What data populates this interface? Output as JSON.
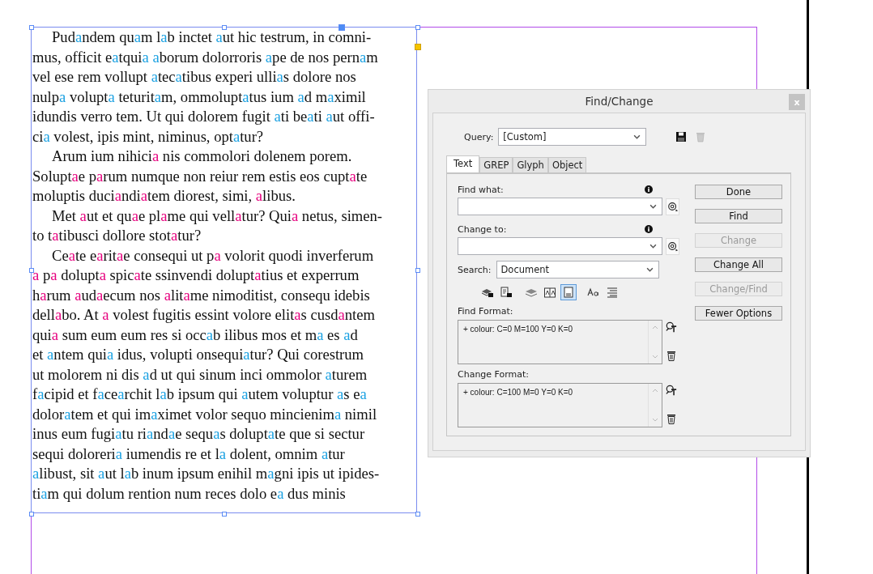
{
  "text_frame": {
    "paragraphs": [
      {
        "lines": [
          [
            "Pud",
            {
              "text": "a",
              "color": "#1ba1e2"
            },
            "ndem qu",
            {
              "text": "a",
              "color": "#1ba1e2"
            },
            "m l",
            {
              "text": "a",
              "color": "#1ba1e2"
            },
            "b inctet ",
            {
              "text": "a",
              "color": "#1ba1e2"
            },
            "ut hic testrum, in comni-"
          ],
          [
            "mus, officit e",
            {
              "text": "a",
              "color": "#1ba1e2"
            },
            "tqui",
            {
              "text": "a a",
              "color": "#1ba1e2"
            },
            "borum dolorroris ",
            {
              "text": "a",
              "color": "#1ba1e2"
            },
            "pe de nos pern",
            {
              "text": "a",
              "color": "#1ba1e2"
            },
            "m"
          ],
          [
            "vel ese rem vollupt ",
            {
              "text": "a",
              "color": "#1ba1e2"
            },
            "tec",
            {
              "text": "a",
              "color": "#1ba1e2"
            },
            "tibus experi ulli",
            {
              "text": "a",
              "color": "#1ba1e2"
            },
            "s dolore nos"
          ],
          [
            "nulp",
            {
              "text": "a",
              "color": "#1ba1e2"
            },
            " volupt",
            {
              "text": "a",
              "color": "#1ba1e2"
            },
            " teturit",
            {
              "text": "a",
              "color": "#1ba1e2"
            },
            "m, ommolupt",
            {
              "text": "a",
              "color": "#1ba1e2"
            },
            "tus ium ",
            {
              "text": "a",
              "color": "#1ba1e2"
            },
            "d m",
            {
              "text": "a",
              "color": "#1ba1e2"
            },
            "ximil"
          ],
          [
            "idundis verro tem. Ut qui dolorem fugit ",
            {
              "text": "a",
              "color": "#1ba1e2"
            },
            "ti be",
            {
              "text": "a",
              "color": "#1ba1e2"
            },
            "ti ",
            {
              "text": "a",
              "color": "#1ba1e2"
            },
            "ut offi-"
          ],
          [
            "ci",
            {
              "text": "a",
              "color": "#1ba1e2"
            },
            " volest, ipis mint, niminus, opt",
            {
              "text": "a",
              "color": "#1ba1e2"
            },
            "tur?"
          ]
        ]
      },
      {
        "lines": [
          [
            "Arum ium nihici",
            {
              "text": "a",
              "color": "#e6007e"
            },
            " nis commolori dolenem porem."
          ],
          [
            "Solupt",
            {
              "text": "a",
              "color": "#e6007e"
            },
            "e p",
            {
              "text": "a",
              "color": "#e6007e"
            },
            "rum numque non reiur rem estis eos cupt",
            {
              "text": "a",
              "color": "#e6007e"
            },
            "te"
          ],
          [
            "moluptis duci",
            {
              "text": "a",
              "color": "#e6007e"
            },
            "ndi",
            {
              "text": "a",
              "color": "#e6007e"
            },
            "tem diorest, simi, ",
            {
              "text": "a",
              "color": "#e6007e"
            },
            "libus."
          ]
        ]
      },
      {
        "lines": [
          [
            "Met ",
            {
              "text": "a",
              "color": "#e6007e"
            },
            "ut et qu",
            {
              "text": "a",
              "color": "#e6007e"
            },
            "e pl",
            {
              "text": "a",
              "color": "#e6007e"
            },
            "me qui vell",
            {
              "text": "a",
              "color": "#e6007e"
            },
            "tur? Qui",
            {
              "text": "a",
              "color": "#e6007e"
            },
            " netus, simen-"
          ],
          [
            "to t",
            {
              "text": "a",
              "color": "#e6007e"
            },
            "tibusci dollore stot",
            {
              "text": "a",
              "color": "#e6007e"
            },
            "tur?"
          ]
        ]
      },
      {
        "lines": [
          [
            "Ce",
            {
              "text": "a",
              "color": "#e6007e"
            },
            "te e",
            {
              "text": "a",
              "color": "#e6007e"
            },
            "rit",
            {
              "text": "a",
              "color": "#e6007e"
            },
            "e consequi ut p",
            {
              "text": "a",
              "color": "#e6007e"
            },
            " volorit quodi inverferum"
          ],
          [
            {
              "text": "a",
              "color": "#e6007e"
            },
            " p",
            {
              "text": "a",
              "color": "#e6007e"
            },
            " dolupt",
            {
              "text": "a",
              "color": "#e6007e"
            },
            " spic",
            {
              "text": "a",
              "color": "#e6007e"
            },
            "te ssinvendi dolupt",
            {
              "text": "a",
              "color": "#e6007e"
            },
            "tius et experrum"
          ],
          [
            "h",
            {
              "text": "a",
              "color": "#e6007e"
            },
            "rum ",
            {
              "text": "a",
              "color": "#e6007e"
            },
            "ud",
            {
              "text": "a",
              "color": "#e6007e"
            },
            "ecum nos ",
            {
              "text": "a",
              "color": "#e6007e"
            },
            "lit",
            {
              "text": "a",
              "color": "#e6007e"
            },
            "me nimoditist, consequ idebis"
          ],
          [
            "dell",
            {
              "text": "a",
              "color": "#e6007e"
            },
            "bo. At ",
            {
              "text": "a",
              "color": "#e6007e"
            },
            " volest fugitis essint volore elit",
            {
              "text": "a",
              "color": "#e6007e"
            },
            "s cusd",
            {
              "text": "a",
              "color": "#e6007e"
            },
            "ntem"
          ],
          [
            "qui",
            {
              "text": "a",
              "color": "#e6007e"
            },
            " sum eum eum res si occ",
            {
              "text": "a",
              "color": "#1ba1e2"
            },
            "b ilibus mos et m",
            {
              "text": "a",
              "color": "#1ba1e2"
            },
            " es ",
            {
              "text": "a",
              "color": "#1ba1e2"
            },
            "d"
          ],
          [
            "et ",
            {
              "text": "a",
              "color": "#1ba1e2"
            },
            "ntem qui",
            {
              "text": "a",
              "color": "#1ba1e2"
            },
            " idus, volupti onsequi",
            {
              "text": "a",
              "color": "#1ba1e2"
            },
            "tur? Qui corestrum"
          ],
          [
            "ut molorem ni dis ",
            {
              "text": "a",
              "color": "#1ba1e2"
            },
            "d ut qui sinum inci ommolor ",
            {
              "text": "a",
              "color": "#1ba1e2"
            },
            "turem"
          ],
          [
            "f",
            {
              "text": "a",
              "color": "#1ba1e2"
            },
            "cipid et f",
            {
              "text": "a",
              "color": "#1ba1e2"
            },
            "ce",
            {
              "text": "a",
              "color": "#1ba1e2"
            },
            "rchit l",
            {
              "text": "a",
              "color": "#1ba1e2"
            },
            "b ipsum qui ",
            {
              "text": "a",
              "color": "#1ba1e2"
            },
            "utem voluptur ",
            {
              "text": "a",
              "color": "#1ba1e2"
            },
            "s e",
            {
              "text": "a",
              "color": "#1ba1e2"
            }
          ],
          [
            "dolor",
            {
              "text": "a",
              "color": "#1ba1e2"
            },
            "tem et qui im",
            {
              "text": "a",
              "color": "#1ba1e2"
            },
            "ximet volor sequo mincienim",
            {
              "text": "a",
              "color": "#1ba1e2"
            },
            " nimil"
          ],
          [
            "inus eum fugi",
            {
              "text": "a",
              "color": "#1ba1e2"
            },
            "tu ri",
            {
              "text": "a",
              "color": "#1ba1e2"
            },
            "nd",
            {
              "text": "a",
              "color": "#1ba1e2"
            },
            "e sequ",
            {
              "text": "a",
              "color": "#1ba1e2"
            },
            "s dolupt",
            {
              "text": "a",
              "color": "#1ba1e2"
            },
            "te que si sectur"
          ],
          [
            "sequi doloreri",
            {
              "text": "a",
              "color": "#1ba1e2"
            },
            " iumendis re et l",
            {
              "text": "a",
              "color": "#1ba1e2"
            },
            " dolent, omnim ",
            {
              "text": "a",
              "color": "#1ba1e2"
            },
            "tur"
          ],
          [
            {
              "text": "a",
              "color": "#1ba1e2"
            },
            "libust, sit ",
            {
              "text": "a",
              "color": "#1ba1e2"
            },
            "ut l",
            {
              "text": "a",
              "color": "#1ba1e2"
            },
            "b inum ipsum enihil m",
            {
              "text": "a",
              "color": "#1ba1e2"
            },
            "gni ipis ut ipides-"
          ],
          [
            "ti",
            {
              "text": "a",
              "color": "#1ba1e2"
            },
            "m qui dolum rention num reces dolo e",
            {
              "text": "a",
              "color": "#1ba1e2"
            },
            " dus minis"
          ]
        ]
      }
    ]
  },
  "dialog": {
    "title": "Find/Change",
    "close": "x",
    "query": {
      "label": "Query:",
      "value": "[Custom]"
    },
    "tabs": [
      {
        "label": "Text",
        "selected": true
      },
      {
        "label": "GREP",
        "selected": false
      },
      {
        "label": "Glyph",
        "selected": false
      },
      {
        "label": "Object",
        "selected": false
      }
    ],
    "find_what": {
      "label": "Find what:"
    },
    "change_to": {
      "label": "Change to:"
    },
    "search": {
      "label": "Search:",
      "value": "Document"
    },
    "search_options": [
      {
        "selected": false
      },
      {
        "selected": false
      },
      {
        "selected": false
      },
      {
        "selected": false
      },
      {
        "selected": true
      },
      {
        "selected": false
      },
      {
        "selected": false
      }
    ],
    "find_format": {
      "label": "Find Format:",
      "value": "+ colour: C=0 M=100 Y=0 K=0"
    },
    "change_format": {
      "label": "Change Format:",
      "value": "+ colour: C=100 M=0 Y=0 K=0"
    },
    "buttons": [
      {
        "label": "Done",
        "disabled": false
      },
      {
        "label": "Find",
        "disabled": false
      },
      {
        "label": "Change",
        "disabled": true
      },
      {
        "label": "Change All",
        "disabled": false
      },
      {
        "label": "Change/Find",
        "disabled": true
      },
      {
        "label": "Fewer Options",
        "disabled": false
      }
    ]
  }
}
